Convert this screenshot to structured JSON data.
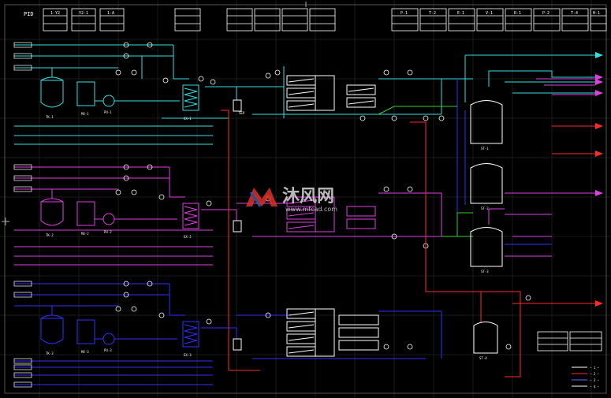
{
  "sheet_label": "PID",
  "title_blocks_left": [
    {
      "top": "1-Y2"
    },
    {
      "top": "Y2-1"
    },
    {
      "top": "1-A"
    }
  ],
  "title_blocks_right": [
    {
      "top": "P-1"
    },
    {
      "top": "T-2"
    },
    {
      "top": "E-1"
    },
    {
      "top": "V-1"
    },
    {
      "top": "R-1"
    },
    {
      "top": "P-2"
    },
    {
      "top": "T-4"
    },
    {
      "top": "H-1"
    }
  ],
  "tags": {
    "tk1": "TK-1",
    "tk2": "TK-2",
    "tk3": "TK-3",
    "mx1": "MX-1",
    "mx2": "MX-2",
    "mx3": "MX-3",
    "pu1": "PU-1",
    "pu2": "PU-2",
    "pu3": "PU-3",
    "ex1": "EX-1",
    "ex2": "EX-2",
    "ex3": "EX-3",
    "st1": "ST-1",
    "st2": "ST-2",
    "st3": "ST-3",
    "st4": "ST-4",
    "sep": "SEP"
  },
  "watermark": {
    "brand_cn": "沐风网",
    "url": "www.mfcad.com",
    "colors": {
      "red": "#d9332b",
      "blue": "#2f5fb3"
    }
  },
  "legend": [
    {
      "label": "— 1 —",
      "color": "#ffffff"
    },
    {
      "label": "— 2 —",
      "color": "#ff3030"
    },
    {
      "label": "— 3 —",
      "color": "#6a6aff"
    },
    {
      "label": "— 4 —",
      "color": "#ffffff"
    }
  ],
  "line_colors": {
    "cyan": "#33e0e0",
    "magenta": "#e040e0",
    "blue": "#3030ff",
    "red": "#ff2a2a",
    "green": "#30d030",
    "white": "#ffffff"
  }
}
